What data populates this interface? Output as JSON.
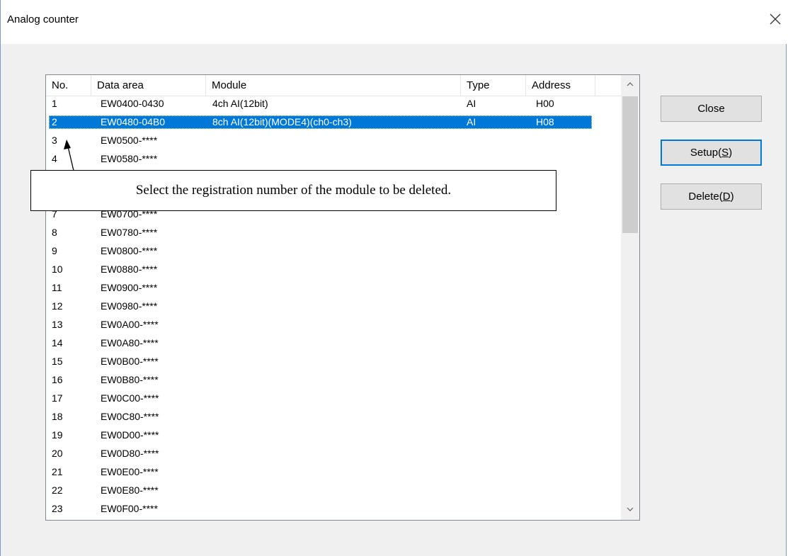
{
  "window": {
    "title": "Analog counter"
  },
  "list": {
    "columns": [
      "No.",
      "Data area",
      "Module",
      "Type",
      "Address"
    ],
    "selected_index": 1,
    "rows": [
      {
        "no": "1",
        "area": "EW0400-0430",
        "module": "4ch AI(12bit)",
        "type": "AI",
        "address": "H00"
      },
      {
        "no": "2",
        "area": "EW0480-04B0",
        "module": "8ch AI(12bit)(MODE4)(ch0-ch3)",
        "type": "AI",
        "address": "H08"
      },
      {
        "no": "3",
        "area": "EW0500-****",
        "module": "",
        "type": "",
        "address": ""
      },
      {
        "no": "4",
        "area": "EW0580-****",
        "module": "",
        "type": "",
        "address": ""
      },
      {
        "no": "",
        "area": "",
        "module": "",
        "type": "",
        "address": ""
      },
      {
        "no": "",
        "area": "",
        "module": "",
        "type": "",
        "address": ""
      },
      {
        "no": "7",
        "area": "EW0700-****",
        "module": "",
        "type": "",
        "address": ""
      },
      {
        "no": "8",
        "area": "EW0780-****",
        "module": "",
        "type": "",
        "address": ""
      },
      {
        "no": "9",
        "area": "EW0800-****",
        "module": "",
        "type": "",
        "address": ""
      },
      {
        "no": "10",
        "area": "EW0880-****",
        "module": "",
        "type": "",
        "address": ""
      },
      {
        "no": "11",
        "area": "EW0900-****",
        "module": "",
        "type": "",
        "address": ""
      },
      {
        "no": "12",
        "area": "EW0980-****",
        "module": "",
        "type": "",
        "address": ""
      },
      {
        "no": "13",
        "area": "EW0A00-****",
        "module": "",
        "type": "",
        "address": ""
      },
      {
        "no": "14",
        "area": "EW0A80-****",
        "module": "",
        "type": "",
        "address": ""
      },
      {
        "no": "15",
        "area": "EW0B00-****",
        "module": "",
        "type": "",
        "address": ""
      },
      {
        "no": "16",
        "area": "EW0B80-****",
        "module": "",
        "type": "",
        "address": ""
      },
      {
        "no": "17",
        "area": "EW0C00-****",
        "module": "",
        "type": "",
        "address": ""
      },
      {
        "no": "18",
        "area": "EW0C80-****",
        "module": "",
        "type": "",
        "address": ""
      },
      {
        "no": "19",
        "area": "EW0D00-****",
        "module": "",
        "type": "",
        "address": ""
      },
      {
        "no": "20",
        "area": "EW0D80-****",
        "module": "",
        "type": "",
        "address": ""
      },
      {
        "no": "21",
        "area": "EW0E00-****",
        "module": "",
        "type": "",
        "address": ""
      },
      {
        "no": "22",
        "area": "EW0E80-****",
        "module": "",
        "type": "",
        "address": ""
      },
      {
        "no": "23",
        "area": "EW0F00-****",
        "module": "",
        "type": "",
        "address": ""
      }
    ]
  },
  "buttons": {
    "close": "Close",
    "setup": {
      "text": "Setup(",
      "key": "S",
      "end": ")"
    },
    "delete": {
      "text": "Delete(",
      "key": "D",
      "end": ")"
    }
  },
  "callout": {
    "text": "Select the registration number of the module to be deleted."
  },
  "icons": {
    "window_close": "close-icon",
    "scroll_up": "chevron-up-icon",
    "scroll_down": "chevron-down-icon"
  },
  "colors": {
    "selection": "#0078d7",
    "default_button_border": "#0078d7"
  }
}
